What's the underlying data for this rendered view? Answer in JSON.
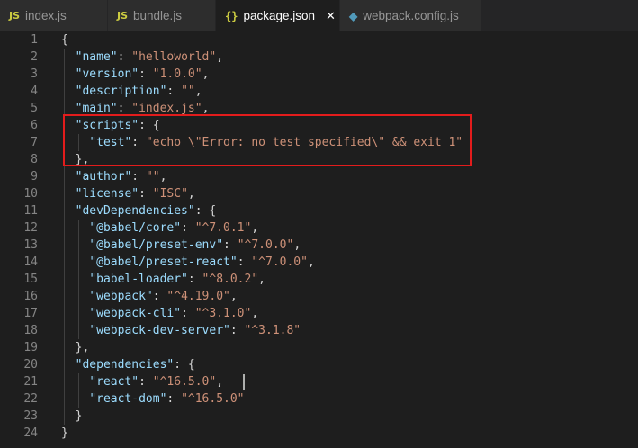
{
  "tabs": [
    {
      "icon": "JS",
      "label": "index.js",
      "active": false
    },
    {
      "icon": "JS",
      "label": "bundle.js",
      "active": false
    },
    {
      "icon": "{}",
      "label": "package.json",
      "active": true,
      "close": "✕"
    },
    {
      "icon": "◆",
      "label": "webpack.config.js",
      "active": false
    }
  ],
  "lines": [
    {
      "n": "1",
      "tokens": [
        {
          "t": "p",
          "v": "{"
        }
      ]
    },
    {
      "n": "2",
      "tokens": [
        {
          "t": "p",
          "v": "  "
        },
        {
          "t": "k",
          "v": "\"name\""
        },
        {
          "t": "p",
          "v": ": "
        },
        {
          "t": "s",
          "v": "\"helloworld\""
        },
        {
          "t": "p",
          "v": ","
        }
      ]
    },
    {
      "n": "3",
      "tokens": [
        {
          "t": "p",
          "v": "  "
        },
        {
          "t": "k",
          "v": "\"version\""
        },
        {
          "t": "p",
          "v": ": "
        },
        {
          "t": "s",
          "v": "\"1.0.0\""
        },
        {
          "t": "p",
          "v": ","
        }
      ]
    },
    {
      "n": "4",
      "tokens": [
        {
          "t": "p",
          "v": "  "
        },
        {
          "t": "k",
          "v": "\"description\""
        },
        {
          "t": "p",
          "v": ": "
        },
        {
          "t": "s",
          "v": "\"\""
        },
        {
          "t": "p",
          "v": ","
        }
      ]
    },
    {
      "n": "5",
      "tokens": [
        {
          "t": "p",
          "v": "  "
        },
        {
          "t": "k",
          "v": "\"main\""
        },
        {
          "t": "p",
          "v": ": "
        },
        {
          "t": "s",
          "v": "\"index.js\""
        },
        {
          "t": "p",
          "v": ","
        }
      ]
    },
    {
      "n": "6",
      "tokens": [
        {
          "t": "p",
          "v": "  "
        },
        {
          "t": "k",
          "v": "\"scripts\""
        },
        {
          "t": "p",
          "v": ": {"
        }
      ]
    },
    {
      "n": "7",
      "tokens": [
        {
          "t": "p",
          "v": "    "
        },
        {
          "t": "k",
          "v": "\"test\""
        },
        {
          "t": "p",
          "v": ": "
        },
        {
          "t": "s",
          "v": "\"echo \\\"Error: no test specified\\\" && exit 1\""
        }
      ]
    },
    {
      "n": "8",
      "tokens": [
        {
          "t": "p",
          "v": "  },"
        }
      ]
    },
    {
      "n": "9",
      "tokens": [
        {
          "t": "p",
          "v": "  "
        },
        {
          "t": "k",
          "v": "\"author\""
        },
        {
          "t": "p",
          "v": ": "
        },
        {
          "t": "s",
          "v": "\"\""
        },
        {
          "t": "p",
          "v": ","
        }
      ]
    },
    {
      "n": "10",
      "tokens": [
        {
          "t": "p",
          "v": "  "
        },
        {
          "t": "k",
          "v": "\"license\""
        },
        {
          "t": "p",
          "v": ": "
        },
        {
          "t": "s",
          "v": "\"ISC\""
        },
        {
          "t": "p",
          "v": ","
        }
      ]
    },
    {
      "n": "11",
      "tokens": [
        {
          "t": "p",
          "v": "  "
        },
        {
          "t": "k",
          "v": "\"devDependencies\""
        },
        {
          "t": "p",
          "v": ": {"
        }
      ]
    },
    {
      "n": "12",
      "tokens": [
        {
          "t": "p",
          "v": "    "
        },
        {
          "t": "k",
          "v": "\"@babel/core\""
        },
        {
          "t": "p",
          "v": ": "
        },
        {
          "t": "s",
          "v": "\"^7.0.1\""
        },
        {
          "t": "p",
          "v": ","
        }
      ]
    },
    {
      "n": "13",
      "tokens": [
        {
          "t": "p",
          "v": "    "
        },
        {
          "t": "k",
          "v": "\"@babel/preset-env\""
        },
        {
          "t": "p",
          "v": ": "
        },
        {
          "t": "s",
          "v": "\"^7.0.0\""
        },
        {
          "t": "p",
          "v": ","
        }
      ]
    },
    {
      "n": "14",
      "tokens": [
        {
          "t": "p",
          "v": "    "
        },
        {
          "t": "k",
          "v": "\"@babel/preset-react\""
        },
        {
          "t": "p",
          "v": ": "
        },
        {
          "t": "s",
          "v": "\"^7.0.0\""
        },
        {
          "t": "p",
          "v": ","
        }
      ]
    },
    {
      "n": "15",
      "tokens": [
        {
          "t": "p",
          "v": "    "
        },
        {
          "t": "k",
          "v": "\"babel-loader\""
        },
        {
          "t": "p",
          "v": ": "
        },
        {
          "t": "s",
          "v": "\"^8.0.2\""
        },
        {
          "t": "p",
          "v": ","
        }
      ]
    },
    {
      "n": "16",
      "tokens": [
        {
          "t": "p",
          "v": "    "
        },
        {
          "t": "k",
          "v": "\"webpack\""
        },
        {
          "t": "p",
          "v": ": "
        },
        {
          "t": "s",
          "v": "\"^4.19.0\""
        },
        {
          "t": "p",
          "v": ","
        }
      ]
    },
    {
      "n": "17",
      "tokens": [
        {
          "t": "p",
          "v": "    "
        },
        {
          "t": "k",
          "v": "\"webpack-cli\""
        },
        {
          "t": "p",
          "v": ": "
        },
        {
          "t": "s",
          "v": "\"^3.1.0\""
        },
        {
          "t": "p",
          "v": ","
        }
      ]
    },
    {
      "n": "18",
      "tokens": [
        {
          "t": "p",
          "v": "    "
        },
        {
          "t": "k",
          "v": "\"webpack-dev-server\""
        },
        {
          "t": "p",
          "v": ": "
        },
        {
          "t": "s",
          "v": "\"^3.1.8\""
        }
      ]
    },
    {
      "n": "19",
      "tokens": [
        {
          "t": "p",
          "v": "  },"
        }
      ]
    },
    {
      "n": "20",
      "tokens": [
        {
          "t": "p",
          "v": "  "
        },
        {
          "t": "k",
          "v": "\"dependencies\""
        },
        {
          "t": "p",
          "v": ": {"
        }
      ]
    },
    {
      "n": "21",
      "tokens": [
        {
          "t": "p",
          "v": "    "
        },
        {
          "t": "k",
          "v": "\"react\""
        },
        {
          "t": "p",
          "v": ": "
        },
        {
          "t": "s",
          "v": "\"^16.5.0\""
        },
        {
          "t": "p",
          "v": ","
        }
      ]
    },
    {
      "n": "22",
      "tokens": [
        {
          "t": "p",
          "v": "    "
        },
        {
          "t": "k",
          "v": "\"react-dom\""
        },
        {
          "t": "p",
          "v": ": "
        },
        {
          "t": "s",
          "v": "\"^16.5.0\""
        }
      ]
    },
    {
      "n": "23",
      "tokens": [
        {
          "t": "p",
          "v": "  }"
        }
      ]
    },
    {
      "n": "24",
      "tokens": [
        {
          "t": "p",
          "v": "}"
        }
      ]
    }
  ],
  "colors": {
    "background": "#1e1e1e",
    "key": "#9cdcfe",
    "string": "#ce9178",
    "punctuation": "#d4d4d4",
    "line_number": "#858585",
    "highlight_box": "#e31c1c"
  }
}
